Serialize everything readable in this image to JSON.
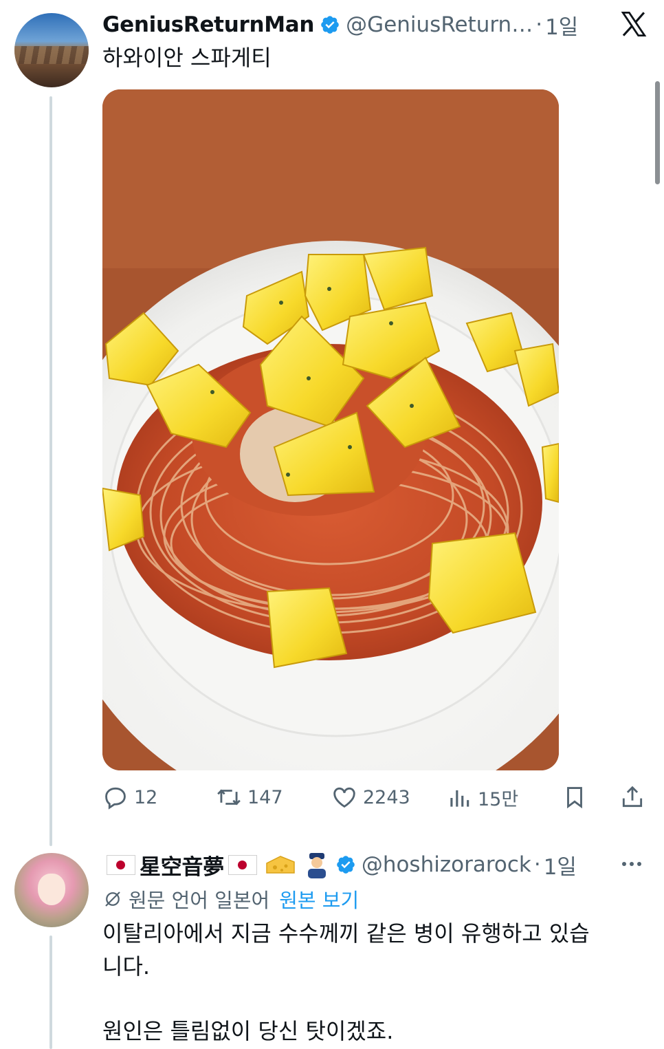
{
  "tweet": {
    "author_name": "GeniusReturnMan",
    "handle": "@GeniusReturn…",
    "separator": "·",
    "time": "1일",
    "text": "하와이안 스파게티",
    "actions": {
      "replies": "12",
      "retweets": "147",
      "likes": "2243",
      "views": "15만"
    }
  },
  "reply": {
    "author_name": "星空音夢",
    "handle": "@hoshizorarock",
    "separator": "·",
    "time": "1일",
    "translated_from": "원문 언어 일본어",
    "show_original": "원본 보기",
    "text_line1": "이탈리아에서 지금 수수께끼 같은 병이 유행하고 있습",
    "text_line2": "니다.",
    "text_line3": "원인은 틀림없이 당신 탓이겠죠."
  },
  "colors": {
    "verified": "#1d9bf0",
    "muted": "#536471",
    "link": "#1d9bf0"
  }
}
